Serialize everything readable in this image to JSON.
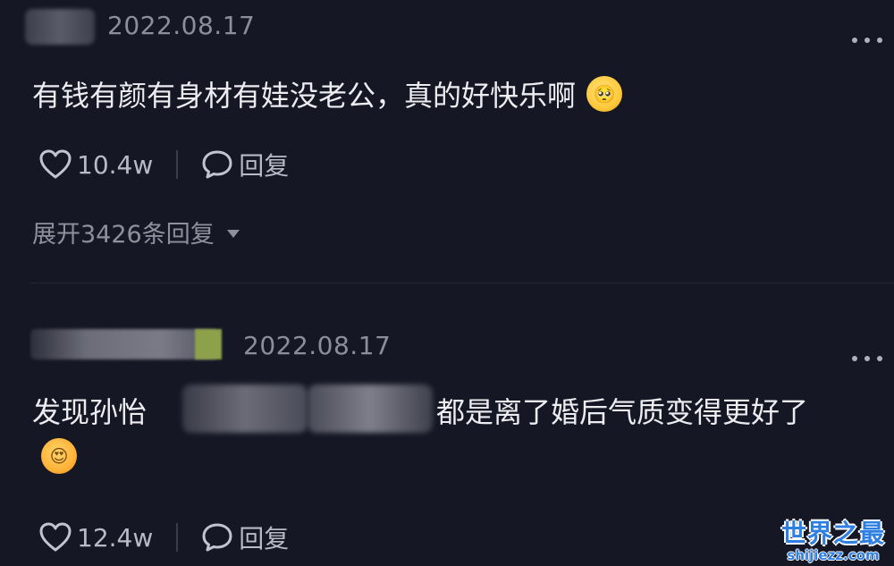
{
  "comments": [
    {
      "date": "2022.08.17",
      "text": "有钱有颜有身材有娃没老公，真的好快乐啊",
      "emoji_icon": "pleading-face-icon",
      "likes": "10.4w",
      "reply_label": "回复",
      "expand_label": "展开3426条回复"
    },
    {
      "date": "2022.08.17",
      "text_prefix": "发现孙怡",
      "text_suffix": "都是离了婚后气质变得更好了",
      "emoji_icon": "heart-eyes-face-icon",
      "likes": "12.4w",
      "reply_label": "回复"
    }
  ],
  "watermark": {
    "title": "世界之最",
    "url": "shijiezz.com"
  },
  "colors": {
    "background": "#161724",
    "text": "#ececf1",
    "muted": "#8d8e9b",
    "watermark_blue": "#2f7fe0"
  }
}
